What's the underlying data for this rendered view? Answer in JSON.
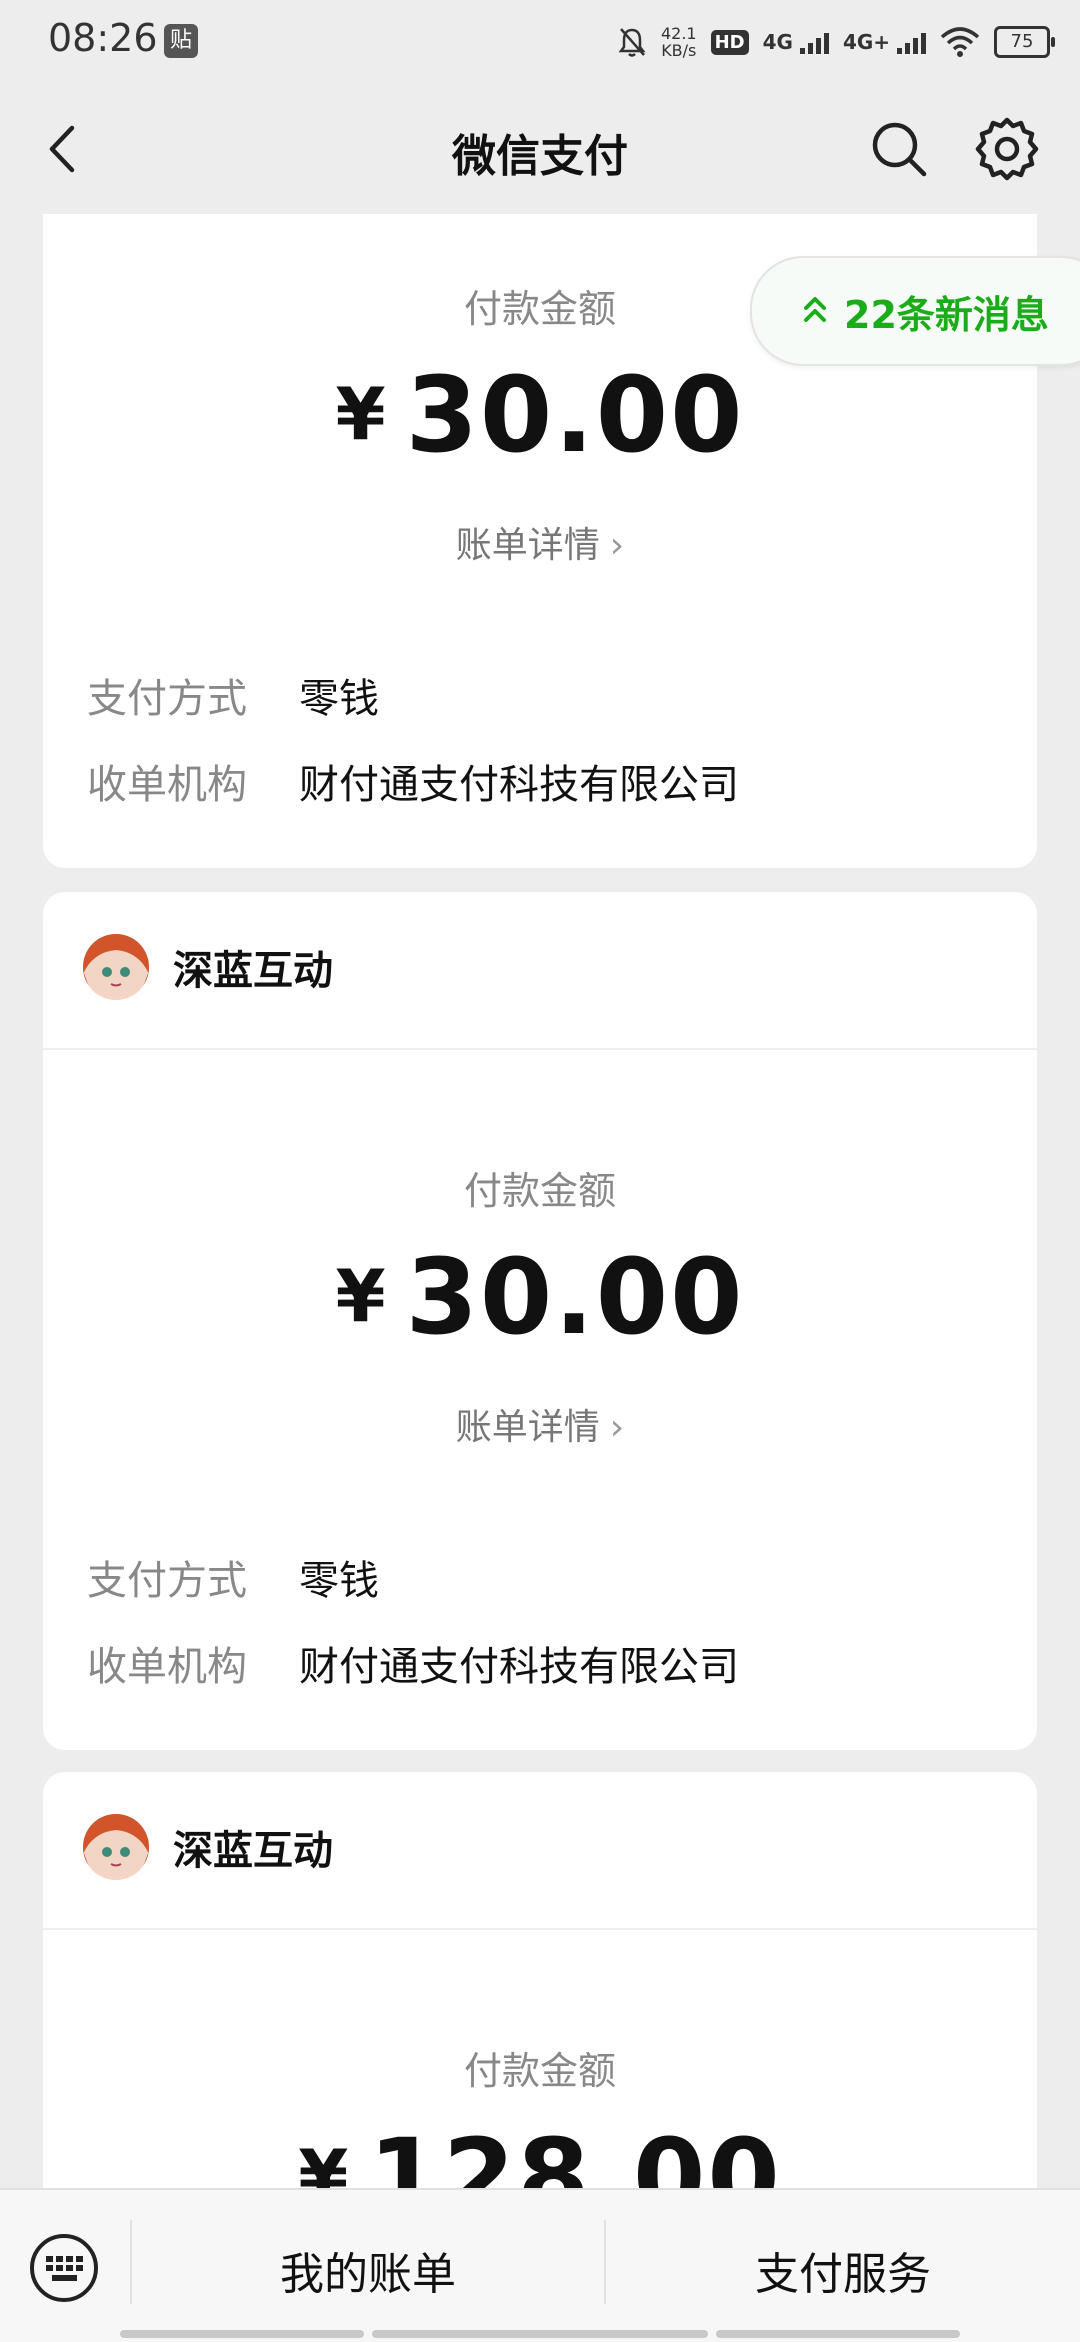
{
  "status_bar": {
    "time": "08:26",
    "app_badge": "贴",
    "net_speed_value": "42.1",
    "net_speed_unit": "KB/s",
    "hd_label": "HD",
    "sim1_label": "4G",
    "sim2_label": "4G+",
    "battery": "75"
  },
  "header": {
    "title": "微信支付",
    "icons": [
      "back-icon",
      "search-icon",
      "gear-icon"
    ]
  },
  "new_messages": {
    "label": "22条新消息",
    "icon": "double-chevron-up-icon"
  },
  "cards": [
    {
      "amount_label": "付款金额",
      "currency": "¥",
      "amount": "30.00",
      "detail_link": "账单详情",
      "rows": [
        {
          "key": "支付方式",
          "value": "零钱"
        },
        {
          "key": "收单机构",
          "value": "财付通支付科技有限公司"
        }
      ]
    },
    {
      "merchant": "深蓝互动",
      "amount_label": "付款金额",
      "currency": "¥",
      "amount": "30.00",
      "detail_link": "账单详情",
      "rows": [
        {
          "key": "支付方式",
          "value": "零钱"
        },
        {
          "key": "收单机构",
          "value": "财付通支付科技有限公司"
        }
      ]
    },
    {
      "merchant": "深蓝互动",
      "amount_label": "付款金额",
      "currency": "¥",
      "amount": "128.00"
    }
  ],
  "bottom_bar": {
    "tab1": "我的账单",
    "tab2": "支付服务",
    "icons": [
      "keyboard-icon"
    ]
  },
  "colors": {
    "accent": "#1aad19",
    "background": "#ededed",
    "card": "#ffffff"
  }
}
